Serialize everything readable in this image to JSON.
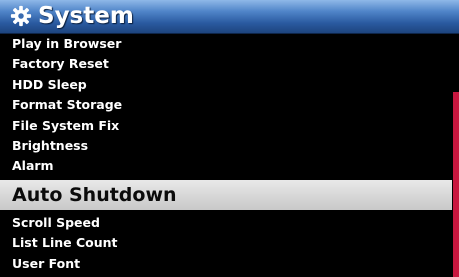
{
  "header": {
    "title": "System",
    "icon": "gear-icon"
  },
  "menu": {
    "items": [
      {
        "label": "Play in Browser"
      },
      {
        "label": "Factory Reset"
      },
      {
        "label": "HDD Sleep"
      },
      {
        "label": "Format Storage"
      },
      {
        "label": "File System Fix"
      },
      {
        "label": "Brightness"
      },
      {
        "label": "Alarm"
      },
      {
        "label": "Auto Shutdown"
      },
      {
        "label": "Scroll Speed"
      },
      {
        "label": "List Line Count"
      },
      {
        "label": "User Font"
      }
    ],
    "selected_label": "Auto Shutdown"
  },
  "colors": {
    "header": "#2a5aa0",
    "selected_row": "#d8d8d8",
    "scrollbar": "#c8173f",
    "background": "#000000"
  }
}
